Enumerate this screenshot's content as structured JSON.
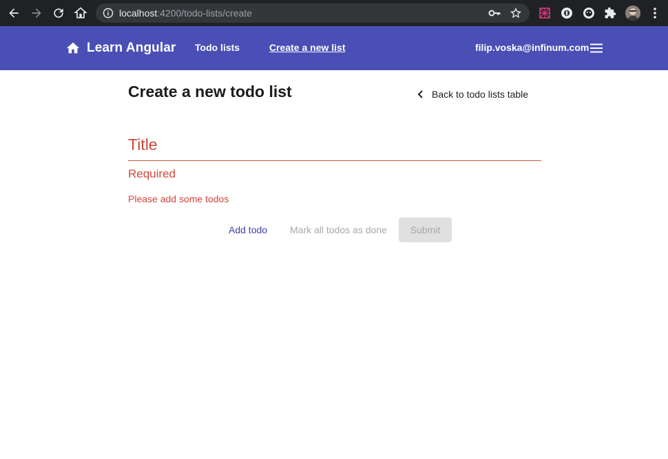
{
  "browser": {
    "url_host": "localhost",
    "url_rest": ":4200/todo-lists/create",
    "icons": [
      "back-arrow-icon",
      "forward-arrow-icon",
      "reload-icon",
      "home-icon",
      "info-icon",
      "key-icon",
      "star-icon",
      "puzzle-extensions-icon",
      "kebab-menu-icon"
    ],
    "colors": {
      "bar": "#202124",
      "address": "#35363a",
      "text": "#e8eaed"
    }
  },
  "header": {
    "brand": "Learn Angular",
    "nav": [
      {
        "label": "Todo lists"
      },
      {
        "label": "Create a new list"
      }
    ],
    "user_email": "filip.voska@infinum.com",
    "colors": {
      "background": "#4a4fb6"
    }
  },
  "main": {
    "title": "Create a new todo list",
    "back_link": "Back to todo lists table",
    "title_field_label": "Title",
    "error_required": "Required",
    "error_todos": "Please add some todos",
    "buttons": {
      "add": "Add todo",
      "mark": "Mark all todos as done",
      "submit": "Submit"
    },
    "colors": {
      "error": "#d0473b",
      "primary": "#3d3fa8",
      "disabled": "#a8a8a8"
    }
  }
}
